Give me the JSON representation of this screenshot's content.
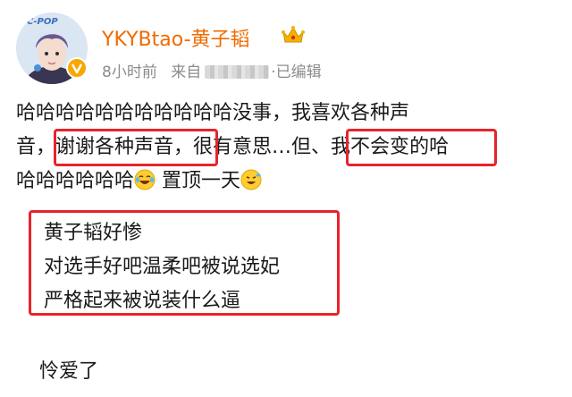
{
  "user": {
    "avatar_icon": "kpop-avatar-icon",
    "avatar_text": "C-POP",
    "name": "YKYBtao-黄子韬",
    "verified_icon": "verified-v-icon",
    "member_icon": "crown-icon"
  },
  "meta": {
    "time": "8小时前",
    "from_label": "来自",
    "edited": "·已编辑"
  },
  "post": {
    "line1": "哈哈哈哈哈哈哈哈哈哈哈没事，我喜欢各种声",
    "line2_a": "音，",
    "line2_b": "谢谢各种声音",
    "line2_c": "，很有意思…",
    "line2_d": "但、我不会变",
    "line2_e": "的哈",
    "line3_a": "哈哈哈哈哈哈",
    "line3_b": " 置顶一天",
    "emoji1": "laugh-tears-emoji-icon",
    "emoji2": "laugh-emoji-icon"
  },
  "quote": {
    "lines": [
      "黄子韬好惨",
      "对选手好吧温柔吧被说选妃",
      "严格起来被说装什么逼"
    ]
  },
  "footer": {
    "text": "怜爱了"
  },
  "colors": {
    "highlight_box": "#e8232b",
    "username": "#f06a00",
    "meta": "#8c8c8c"
  }
}
